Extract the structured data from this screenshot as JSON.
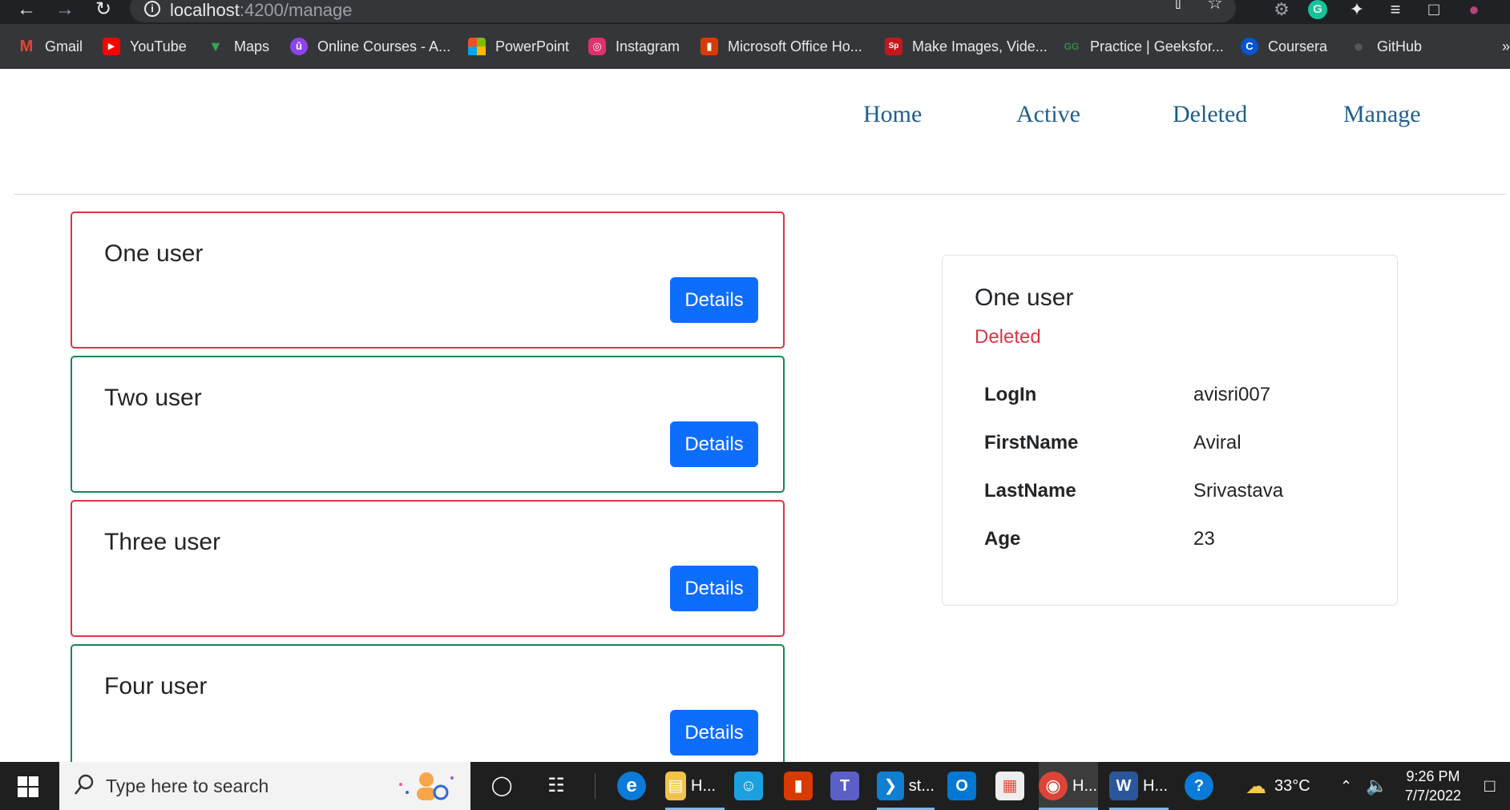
{
  "browser": {
    "url_host": "localhost",
    "url_path": ":4200/manage",
    "nav": {
      "back_icon": "←",
      "forward_icon": "→",
      "reload_icon": "↻"
    },
    "omnibox_icons": {
      "share_icon": "⇧",
      "star_icon": "☆"
    },
    "extensions": [
      "⚙",
      "G",
      "✦",
      "≡",
      "□",
      "●"
    ],
    "bookmarks": [
      {
        "label": "Gmail",
        "icon": "M",
        "color": "#ea4335"
      },
      {
        "label": "YouTube",
        "icon": "▶",
        "color": "#ff0000"
      },
      {
        "label": "Maps",
        "icon": "▼",
        "color": "#34a853"
      },
      {
        "label": "Online Courses - A...",
        "icon": "û",
        "color": "#8e44ec"
      },
      {
        "label": "PowerPoint",
        "icon": "▦",
        "color": "#f25022"
      },
      {
        "label": "Instagram",
        "icon": "◎",
        "color": "#e1306c"
      },
      {
        "label": "Microsoft Office Ho...",
        "icon": "▮",
        "color": "#d83b01"
      },
      {
        "label": "Make Images, Vide...",
        "icon": "Sp",
        "color": "#c4161c"
      },
      {
        "label": "Practice | Geeksfor...",
        "icon": "GG",
        "color": "#2f8d46"
      },
      {
        "label": "Coursera",
        "icon": "C",
        "color": "#0056d2"
      },
      {
        "label": "GitHub",
        "icon": "●",
        "color": "#444444"
      }
    ],
    "more_icon": "»"
  },
  "site_nav": {
    "links": [
      "Home",
      "Active",
      "Deleted",
      "Manage"
    ]
  },
  "users": [
    {
      "name": "One user",
      "status": "deleted",
      "button": "Details"
    },
    {
      "name": "Two user",
      "status": "active",
      "button": "Details"
    },
    {
      "name": "Three user",
      "status": "deleted",
      "button": "Details"
    },
    {
      "name": "Four user",
      "status": "active",
      "button": "Details"
    }
  ],
  "detail": {
    "title": "One user",
    "status": "Deleted",
    "rows": [
      {
        "key": "LogIn",
        "value": "avisri007"
      },
      {
        "key": "FirstName",
        "value": "Aviral"
      },
      {
        "key": "LastName",
        "value": "Srivastava"
      },
      {
        "key": "Age",
        "value": "23"
      }
    ]
  },
  "colors": {
    "deleted_border": "#dc3545",
    "active_border": "#198754",
    "button": "#0d6efd",
    "nav_link": "#1f5f8b"
  },
  "taskbar": {
    "search_placeholder": "Type here to search",
    "start_icon": "windows-logo",
    "apps": [
      {
        "name": "cortana",
        "icon": "◯",
        "label": "",
        "color": "transparent"
      },
      {
        "name": "task-view",
        "icon": "☷",
        "label": "",
        "color": "transparent"
      },
      {
        "name": "edge",
        "icon": "e",
        "label": "",
        "color": "#0c7bd7"
      },
      {
        "name": "file-explorer",
        "icon": "▤",
        "label": "H...",
        "color": "#f2c34b"
      },
      {
        "name": "people",
        "icon": "☺",
        "label": "",
        "color": "#1ba1e2"
      },
      {
        "name": "office",
        "icon": "▮",
        "label": "",
        "color": "#d83b01"
      },
      {
        "name": "teams",
        "icon": "T",
        "label": "",
        "color": "#5b5fc7"
      },
      {
        "name": "vscode",
        "icon": "❯",
        "label": "st...",
        "color": "#0e7fd1"
      },
      {
        "name": "outlook",
        "icon": "O",
        "label": "",
        "color": "#0078d4"
      },
      {
        "name": "store",
        "icon": "▦",
        "label": "",
        "color": "#eeeeee"
      },
      {
        "name": "chrome",
        "icon": "◉",
        "label": "H...",
        "color": "#db4437"
      },
      {
        "name": "word",
        "icon": "W",
        "label": "H...",
        "color": "#2b579a"
      },
      {
        "name": "help",
        "icon": "?",
        "label": "",
        "color": "#0a7bd8"
      }
    ],
    "weather": "33°C",
    "time": "9:26 PM",
    "date": "7/7/2022"
  }
}
